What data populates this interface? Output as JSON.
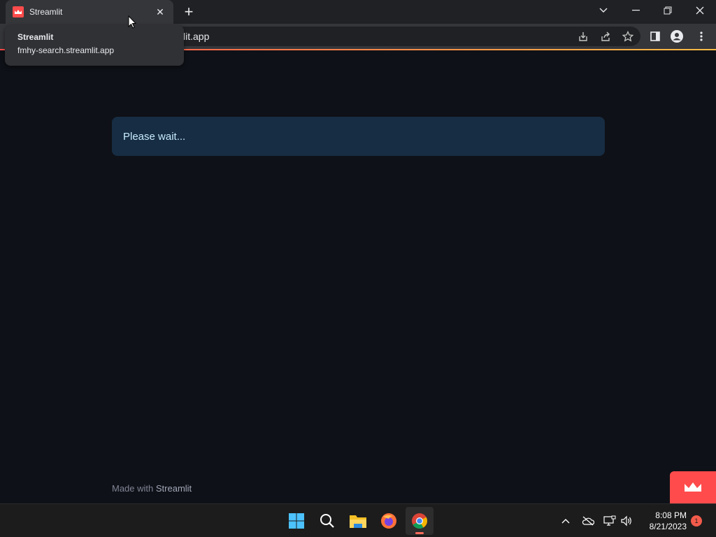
{
  "browser": {
    "tab_title": "Streamlit",
    "tab_close": "✕",
    "new_tab": "+",
    "url_visible": "lit.app",
    "tooltip": {
      "title": "Streamlit",
      "url": "fmhy-search.streamlit.app"
    },
    "window_controls": [
      "⌄",
      "—",
      "❐",
      "✕"
    ]
  },
  "app": {
    "alert_text": "Please wait...",
    "footer_prefix": "Made with ",
    "footer_brand": "Streamlit",
    "accent": "#ff4b4b"
  },
  "taskbar": {
    "apps": [
      "start-icon",
      "search-icon",
      "file-explorer-icon",
      "firefox-icon",
      "chrome-icon"
    ],
    "clock_time": "8:08 PM",
    "clock_date": "8/21/2023",
    "notification_count": "1"
  }
}
